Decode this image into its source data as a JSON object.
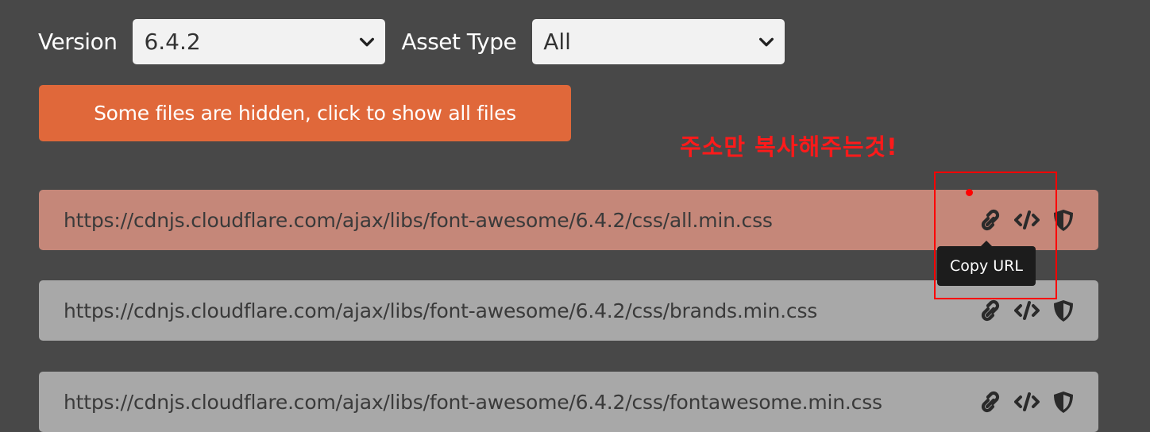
{
  "controls": {
    "version_label": "Version",
    "version_value": "6.4.2",
    "asset_type_label": "Asset Type",
    "asset_type_value": "All"
  },
  "notice_button": "Some files are hidden, click to show all files",
  "annotation_text": "주소만 복사해주는것!",
  "tooltip": "Copy URL",
  "files": [
    "https://cdnjs.cloudflare.com/ajax/libs/font-awesome/6.4.2/css/all.min.css",
    "https://cdnjs.cloudflare.com/ajax/libs/font-awesome/6.4.2/css/brands.min.css",
    "https://cdnjs.cloudflare.com/ajax/libs/font-awesome/6.4.2/css/fontawesome.min.css"
  ],
  "row_icons": [
    "link-icon",
    "code-icon",
    "shield-icon"
  ],
  "colors": {
    "background": "#484848",
    "accent_orange": "#e0683a",
    "active_row": "#c58779",
    "row": "#a8a8a8",
    "annotation_red": "#ff1a1a"
  }
}
